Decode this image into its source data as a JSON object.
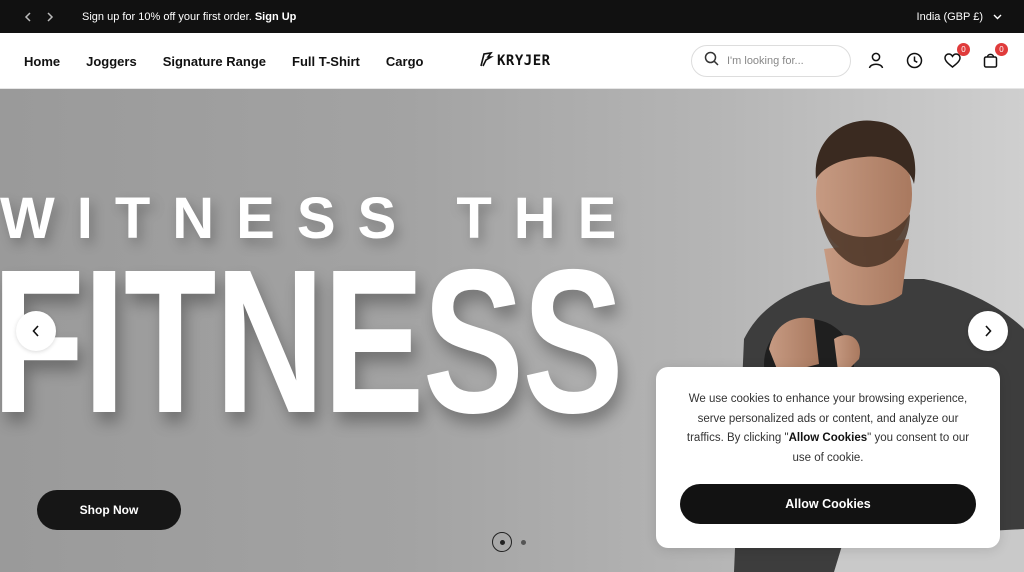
{
  "announcement": {
    "promo_text": "Sign up for 10% off your first order.",
    "promo_link": "Sign Up",
    "region": "India (GBP £)"
  },
  "header": {
    "nav": [
      "Home",
      "Joggers",
      "Signature Range",
      "Full T-Shirt",
      "Cargo"
    ],
    "logo": "KRYJER",
    "search_placeholder": "I'm looking for...",
    "wishlist_count": "0",
    "cart_count": "0"
  },
  "hero": {
    "line1": "WITNESS THE",
    "line2": "FITNESS",
    "cta": "Shop Now",
    "slides_total": 2,
    "active_slide": 1
  },
  "cookie": {
    "text_before": "We use cookies to enhance your browsing experience, serve personalized ads or content, and analyze our traffics. By clicking \"",
    "text_bold": "Allow Cookies",
    "text_after": "\" you consent to our use of cookie.",
    "button": "Allow Cookies"
  },
  "colors": {
    "bar_bg": "#111111",
    "badge": "#e03b3b",
    "button_dark": "#161616"
  }
}
